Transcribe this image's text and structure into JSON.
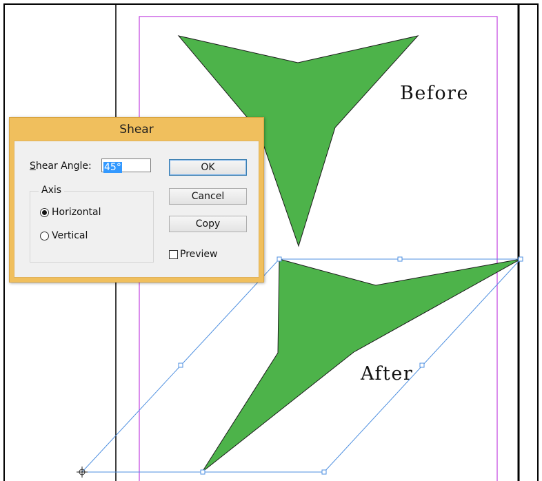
{
  "canvas": {
    "label_before": "Before",
    "label_after": "After",
    "shape_color": "#4db34a",
    "margin_guide_color": "#c040e0",
    "selection_color": "#4d8fe0"
  },
  "dialog": {
    "title": "Shear",
    "shear_angle_label_prefix": "S",
    "shear_angle_label_rest": "hear Angle:",
    "shear_angle_value": "45°",
    "axis_legend": "Axis",
    "axis_options": {
      "horizontal": "Horizontal",
      "vertical": "Vertical"
    },
    "axis_selected": "Horizontal",
    "ok_label": "OK",
    "cancel_label": "Cancel",
    "copy_label": "Copy",
    "preview_label": "Preview",
    "preview_checked": false,
    "title_bar_color": "#f0bf5d"
  }
}
